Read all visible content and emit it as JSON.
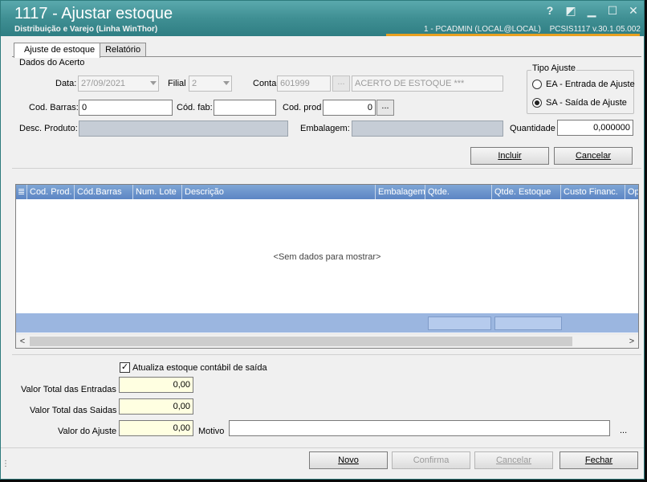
{
  "window": {
    "title": "1117 - Ajustar estoque",
    "subtitle": "Distribuição e Varejo (Linha WinThor)",
    "user_info": "1 - PCADMIN (LOCAL@LOCAL)",
    "version": "PCSIS1117  v.30.1.05.002",
    "help_glyph": "?",
    "restore_glyph": "◩",
    "minimize_glyph": "▁",
    "maximize_glyph": "☐",
    "close_glyph": "✕"
  },
  "tabs": [
    {
      "label": "Ajuste de estoque",
      "active": true
    },
    {
      "label": "Relatório",
      "active": false
    }
  ],
  "dados": {
    "group_title": "Dados do Acerto",
    "data_label": "Data:",
    "data_value": "27/09/2021",
    "filial_label": "Filial",
    "filial_value": "2",
    "conta_label": "Conta",
    "conta_value": "601999",
    "conta_btn": "...",
    "conta_desc": "ACERTO DE ESTOQUE ***",
    "codbarras_label": "Cod. Barras:",
    "codbarras_value": "0",
    "codfab_label": "Cód. fab:",
    "codfab_value": "",
    "codprod_label": "Cod. prod",
    "codprod_value": "0",
    "codprod_btn": "...",
    "desc_label": "Desc. Produto:",
    "desc_value": "",
    "embalagem_label": "Embalagem:",
    "embalagem_value": "",
    "quantidade_label": "Quantidade",
    "quantidade_value": "0,000000"
  },
  "tipo_ajuste": {
    "title": "Tipo Ajuste",
    "options": [
      {
        "label": "EA - Entrada de Ajuste",
        "checked": false
      },
      {
        "label": "SA - Saída de Ajuste",
        "checked": true
      }
    ]
  },
  "actions": {
    "incluir": "Incluir",
    "cancelar": "Cancelar"
  },
  "grid": {
    "columns": [
      "Cod. Prod.",
      "Cód.Barras",
      "Num. Lote",
      "Descrição",
      "Embalagem",
      "Qtde.",
      "Qtde. Estoque",
      "Custo Financ.",
      "Op"
    ],
    "empty_text": "<Sem dados para mostrar>",
    "scroll_left": "<",
    "scroll_right": ">"
  },
  "totals": {
    "atualiza_label": "Atualiza estoque contábil de saída",
    "atualiza_checked": true,
    "atualiza_mark": "✓",
    "entradas_label": "Valor Total das Entradas",
    "entradas_value": "0,00",
    "saidas_label": "Valor Total das Saidas",
    "saidas_value": "0,00",
    "ajuste_label": "Valor do Ajuste",
    "ajuste_value": "0,00",
    "motivo_label": "Motivo",
    "motivo_value": "",
    "motivo_more": "..."
  },
  "footer": {
    "novo": "Novo",
    "confirma": "Confirma",
    "cancelar": "Cancelar",
    "fechar": "Fechar"
  }
}
